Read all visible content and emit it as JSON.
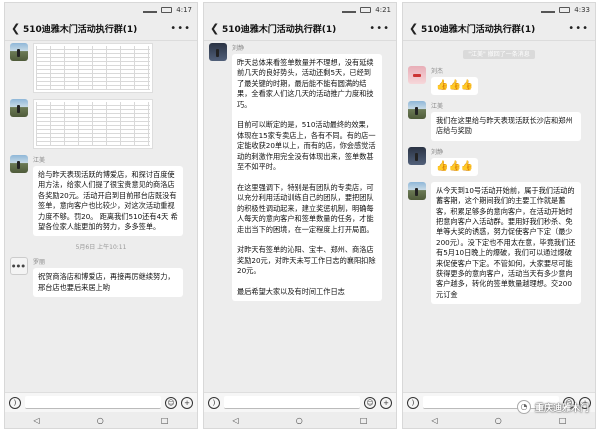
{
  "phones": [
    {
      "time": "4:17",
      "title": "510迪雅木门活动执行群(1)",
      "timestamp": "5月6日 上午10:11",
      "sender_a": "江美",
      "text_a": "给与昨天表现活跃的博爱店，和探讨百度使用方法，给家人们提了很宝贵意见的商洛店各奖励20元。活动开启到目前邢台店既没有签单，意向客户也比较少，对这次活动重视力度不够。罚20。  距离我们510还有4天 希望各位家人能更加的努力，多多签单。",
      "sender_b": "罗丽",
      "text_b": "祝贺商洛店和博爱店，再接再厉继续努力，邢台店也要后来居上哟"
    },
    {
      "time": "4:21",
      "title": "510迪雅木门活动执行群(1)",
      "sender": "刘静",
      "para1": "昨天总体来看签单数量并不理想，没有延续前几天的良好势头，活动还剩5天，已经到了最关键的时期，最后能不能有圆满的结果，全看家人们这几天的活动推广力度和技巧。",
      "para2": "目前可以断定的是，510活动最终的效果，体现在15家专卖店上，各有不同。有的店一定能收获20单以上，而有的店，你会感觉活动的刺激作用完全没有体现出来，签单数甚至不如平时。",
      "para3": "在这里强调下，特别是有团队的专卖店，可以充分利用活动训练自己的团队，要把团队的积极性调动起来，建立奖惩机制，明确每人每天的意向客户和签单数量的任务，才能走出当下的困境，在一定程度上打开局面。",
      "para4": "对昨天有签单的沁阳、宝丰、郑州、商洛店奖励20元，对昨天未写工作日志的襄阳扣除20元。",
      "para5": "最后希望大家以及有时间工作日志"
    },
    {
      "time": "4:33",
      "title": "510迪雅木门活动执行群(1)",
      "sysnote": "\"江美\" 撤回了一条消息",
      "sender_a": "刘杰",
      "emoji": "👍👍👍",
      "sender_b": "江美",
      "text_b": "我们在这里给与昨天表现活跃长沙店和郑州店给与奖励",
      "sender_c": "刘静",
      "emoji_c": "👍👍👍",
      "sender_d": "",
      "text_d": "从今天到10号活动开始前，属于我们活动的蓄客期，这个期间我们的主要工作就是蓄客，积累足够多的意向客户，在活动开始时把意向客户入活动群。要用好我们秒杀、免单等大奖的诱惑，努力促使客户下定（最少200元）。没下定也不用太在意，毕竟我们还有5月10日晚上的爆破，我们可以通过爆破来促使客户下定。不管如何，大家要尽可能获得更多的意向客户，活动当天有多少意向客户越多，转化的签单数量越理想。交200元订金"
    }
  ],
  "watermark": "重庆迪雅木门"
}
